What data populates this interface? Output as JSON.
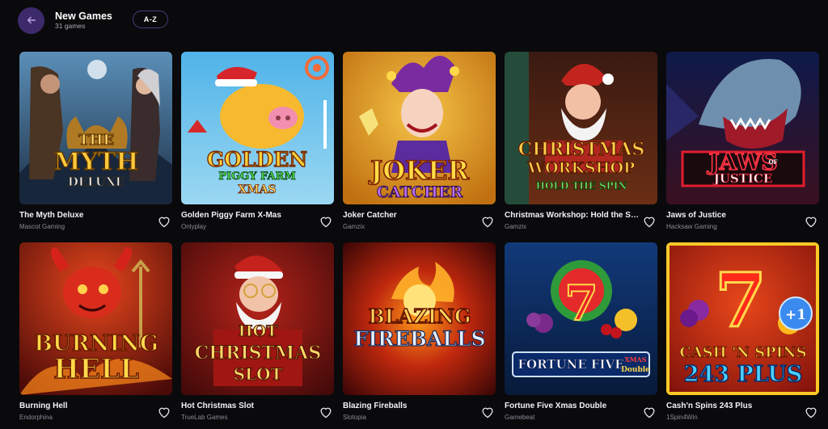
{
  "header": {
    "back_icon": "arrow-left-icon",
    "title": "New Games",
    "count": "31 games",
    "sort_label": "A-Z"
  },
  "colors": {
    "background": "#0a0a0c",
    "back_button": "#3d2a6b",
    "sort_border": "#4b3a7d"
  },
  "games": [
    {
      "name": "The Myth Deluxe",
      "provider": "Mascot Gaming",
      "art": [
        "THE",
        "MYTH",
        "DELUXE"
      ]
    },
    {
      "name": "Golden Piggy Farm X-Mas",
      "provider": "Onlyplay",
      "art": [
        "GOLDEN",
        "PIGGY FARM",
        "XMAS"
      ]
    },
    {
      "name": "Joker Catcher",
      "provider": "Gamzix",
      "art": [
        "JOKER",
        "CATCHER"
      ]
    },
    {
      "name": "Christmas Workshop: Hold the Spin",
      "provider": "Gamzix",
      "art": [
        "CHRISTMAS",
        "WORKSHOP",
        "HOLD THE SPIN"
      ]
    },
    {
      "name": "Jaws of Justice",
      "provider": "Hacksaw Gaming",
      "art": [
        "JAWS",
        "OF",
        "JUSTICE"
      ]
    },
    {
      "name": "Burning Hell",
      "provider": "Endorphina",
      "art": [
        "BURNING",
        "HELL"
      ]
    },
    {
      "name": "Hot Christmas Slot",
      "provider": "TrueLab Games",
      "art": [
        "HOT",
        "CHRISTMAS",
        "SLOT"
      ]
    },
    {
      "name": "Blazing Fireballs",
      "provider": "Slotopia",
      "art": [
        "BLAZING",
        "FIREBALLS"
      ]
    },
    {
      "name": "Fortune Five Xmas Double",
      "provider": "Gamebeat",
      "art": [
        "FORTUNE FIVE",
        "XMAS",
        "Double"
      ]
    },
    {
      "name": "Cash'n Spins 243 Plus",
      "provider": "1Spin4Win",
      "art": [
        "CASH 'N SPINS",
        "243 PLUS",
        "+1"
      ]
    }
  ]
}
